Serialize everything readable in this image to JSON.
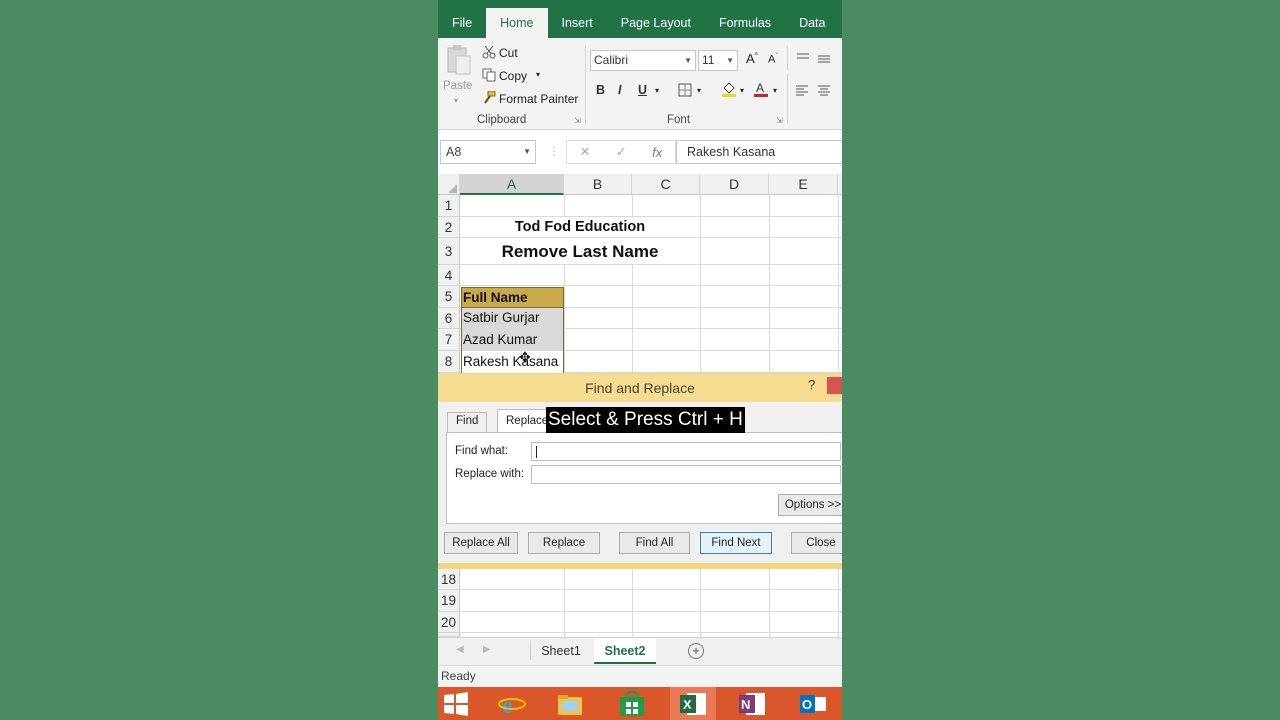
{
  "ribbon": {
    "tabs": [
      "File",
      "Home",
      "Insert",
      "Page Layout",
      "Formulas",
      "Data"
    ],
    "active_tab": "Home",
    "clipboard": {
      "paste": "Paste",
      "cut": "Cut",
      "copy": "Copy",
      "format_painter": "Format Painter",
      "group_label": "Clipboard"
    },
    "font": {
      "font_name": "Calibri",
      "font_size": "11",
      "bold": "B",
      "italic": "I",
      "underline": "U",
      "group_label": "Font"
    }
  },
  "formula_bar": {
    "name_box": "A8",
    "cancel": "✕",
    "enter": "✓",
    "fx": "fx",
    "value": "Rakesh Kasana"
  },
  "grid": {
    "columns": [
      "A",
      "B",
      "C",
      "D",
      "E"
    ],
    "rows_top": [
      "1",
      "2",
      "3",
      "4",
      "5",
      "6",
      "7",
      "8"
    ],
    "title1": "Tod Fod Education",
    "title2": "Remove Last Name",
    "header": "Full Name",
    "names": [
      "Satbir Gurjar",
      "Azad Kumar",
      "Rakesh Kasana"
    ],
    "rows_bottom": [
      "18",
      "19",
      "20"
    ]
  },
  "dialog": {
    "title": "Find and Replace",
    "help": "?",
    "tab_find": "Find",
    "tab_replace": "Replace",
    "find_label": "Find what:",
    "replace_label": "Replace with:",
    "find_value": "",
    "replace_value": "",
    "options": "Options >>",
    "replace_all": "Replace All",
    "replace": "Replace",
    "find_all": "Find All",
    "find_next": "Find Next",
    "close": "Close"
  },
  "caption": "Select & Press Ctrl + H",
  "sheets": {
    "tabs": [
      "Sheet1",
      "Sheet2"
    ],
    "active": "Sheet2",
    "add": "+"
  },
  "status": "Ready",
  "taskbar_icons": [
    "windows-start-icon",
    "internet-explorer-icon",
    "file-explorer-icon",
    "store-icon",
    "excel-icon",
    "onenote-icon",
    "outlook-icon"
  ],
  "colors": {
    "excel_green": "#217346",
    "header_fill": "#c9a94a",
    "dialog_title": "#f6dc8e",
    "taskbar": "#d9572b"
  }
}
